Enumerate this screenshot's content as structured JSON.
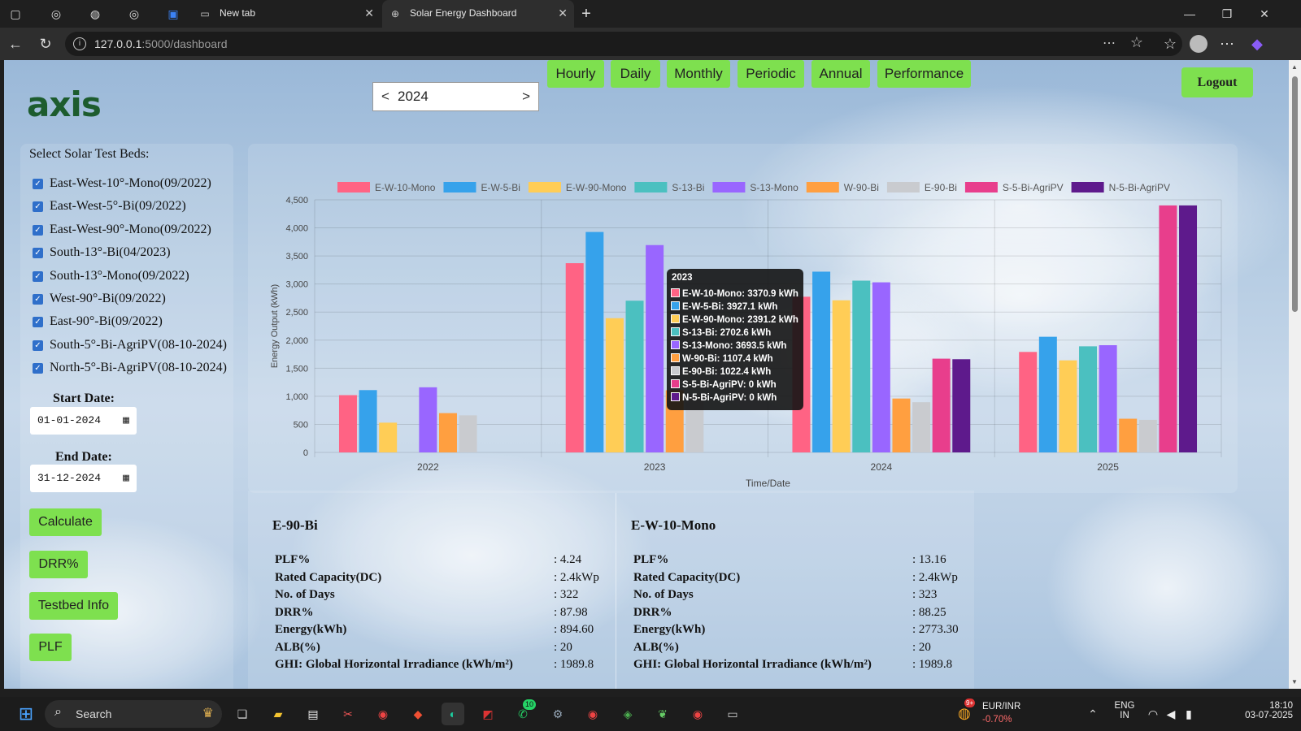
{
  "browser": {
    "tabs": [
      {
        "label": "New tab"
      },
      {
        "label": "Solar Energy Dashboard"
      }
    ],
    "url_host": "127.0.0.1",
    "url_path": ":5000/dashboard"
  },
  "header": {
    "logo_text": "axis",
    "year_prev": "<",
    "year_value": "2024",
    "year_next": ">",
    "view_buttons": [
      "Hourly",
      "Daily",
      "Monthly",
      "Periodic",
      "Annual",
      "Performance"
    ],
    "logout_label": "Logout"
  },
  "sidebar": {
    "title": "Select Solar Test Beds:",
    "testbeds": [
      "East-West-10°-Mono(09/2022)",
      "East-West-5°-Bi(09/2022)",
      "East-West-90°-Mono(09/2022)",
      "South-13°-Bi(04/2023)",
      "South-13°-Mono(09/2022)",
      "West-90°-Bi(09/2022)",
      "East-90°-Bi(09/2022)",
      "South-5°-Bi-AgriPV(08-10-2024)",
      "North-5°-Bi-AgriPV(08-10-2024)"
    ],
    "start_date_label": "Start Date:",
    "start_date_value": "01-01-2024",
    "end_date_label": "End Date:",
    "end_date_value": "31-12-2024",
    "buttons": [
      "Calculate",
      "DRR%",
      "Testbed Info",
      "PLF"
    ]
  },
  "chart_data": {
    "type": "bar",
    "categories": [
      "2022",
      "2023",
      "2024",
      "2025"
    ],
    "xlabel": "Time/Date",
    "ylabel": "Energy Output (kWh)",
    "ylim": [
      0,
      4500
    ],
    "yticks": [
      "0",
      "500",
      "1,000",
      "1,500",
      "2,000",
      "2,500",
      "3,000",
      "3,500",
      "4,000",
      "4,500"
    ],
    "legend_position": "top",
    "series": [
      {
        "name": "E-W-10-Mono",
        "color": "#ff6384",
        "values": [
          1020,
          3370.9,
          2773.3,
          1790
        ]
      },
      {
        "name": "E-W-5-Bi",
        "color": "#36a2eb",
        "values": [
          1110,
          3927.1,
          3220,
          2060
        ]
      },
      {
        "name": "E-W-90-Mono",
        "color": "#ffcd56",
        "values": [
          530,
          2391.2,
          2710,
          1640
        ]
      },
      {
        "name": "S-13-Bi",
        "color": "#4bc0c0",
        "values": [
          0,
          2702.6,
          3060,
          1890
        ]
      },
      {
        "name": "S-13-Mono",
        "color": "#9966ff",
        "values": [
          1160,
          3693.5,
          3030,
          1910
        ]
      },
      {
        "name": "W-90-Bi",
        "color": "#ff9f40",
        "values": [
          700,
          1107.4,
          960,
          600
        ]
      },
      {
        "name": "E-90-Bi",
        "color": "#c9cbcf",
        "values": [
          660,
          1022.4,
          894.6,
          580
        ]
      },
      {
        "name": "S-5-Bi-AgriPV",
        "color": "#e83e8c",
        "values": [
          0,
          0,
          1670,
          4400
        ]
      },
      {
        "name": "N-5-Bi-AgriPV",
        "color": "#5e1a8c",
        "values": [
          0,
          0,
          1660,
          4400
        ]
      }
    ],
    "tooltip": {
      "title": "2023",
      "rows": [
        "E-W-10-Mono: 3370.9 kWh",
        "E-W-5-Bi: 3927.1 kWh",
        "E-W-90-Mono: 2391.2 kWh",
        "S-13-Bi: 2702.6 kWh",
        "S-13-Mono: 3693.5 kWh",
        "W-90-Bi: 1107.4 kWh",
        "E-90-Bi: 1022.4 kWh",
        "S-5-Bi-AgriPV: 0 kWh",
        "N-5-Bi-AgriPV: 0 kWh"
      ]
    }
  },
  "stats": [
    {
      "title": "E-90-Bi",
      "rows": [
        {
          "k": "PLF%",
          "v": ": 4.24"
        },
        {
          "k": "Rated Capacity(DC)",
          "v": ": 2.4kWp"
        },
        {
          "k": "No. of Days",
          "v": ": 322"
        },
        {
          "k": "DRR%",
          "v": ": 87.98"
        },
        {
          "k": "Energy(kWh)",
          "v": ": 894.60"
        },
        {
          "k": "ALB(%)",
          "v": ": 20"
        },
        {
          "k": "GHI: Global Horizontal Irradiance (kWh/m²)",
          "v": ": 1989.8"
        }
      ]
    },
    {
      "title": "E-W-10-Mono",
      "rows": [
        {
          "k": "PLF%",
          "v": ": 13.16"
        },
        {
          "k": "Rated Capacity(DC)",
          "v": ": 2.4kWp"
        },
        {
          "k": "No. of Days",
          "v": ": 323"
        },
        {
          "k": "DRR%",
          "v": ": 88.25"
        },
        {
          "k": "Energy(kWh)",
          "v": ": 2773.30"
        },
        {
          "k": "ALB(%)",
          "v": ": 20"
        },
        {
          "k": "GHI: Global Horizontal Irradiance (kWh/m²)",
          "v": ": 1989.8"
        }
      ]
    }
  ],
  "taskbar": {
    "search_label": "Search",
    "whatsapp_badge": "10",
    "currency_pair": "EUR/INR",
    "currency_change": "-0.70%",
    "currency_badge": "9+",
    "lang_line1": "ENG",
    "lang_line2": "IN",
    "time": "18:10",
    "date": "03-07-2025"
  }
}
